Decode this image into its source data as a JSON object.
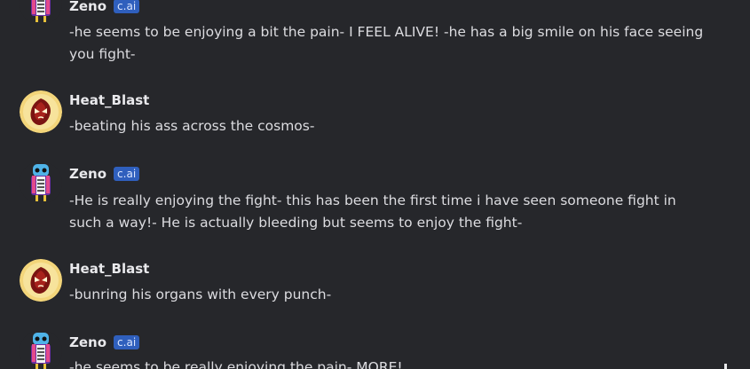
{
  "messages": [
    {
      "author": "Zeno",
      "badge": "c.ai",
      "avatar_icon": "zeno-avatar-icon",
      "text": "-he seems to be enjoying a bit the pain- I FEEL ALIVE! -he has a big smile on his face seeing you fight-"
    },
    {
      "author": "Heat_Blast",
      "badge": "",
      "avatar_icon": "heatblast-avatar-icon",
      "text": "-beating his ass across the cosmos-"
    },
    {
      "author": "Zeno",
      "badge": "c.ai",
      "avatar_icon": "zeno-avatar-icon",
      "text": "-He is really enjoying the fight- this has been the first time i have seen someone fight in such a way!- He is actually bleeding but seems to enjoy the fight-"
    },
    {
      "author": "Heat_Blast",
      "badge": "",
      "avatar_icon": "heatblast-avatar-icon",
      "text": "-bunring his organs with every punch-"
    },
    {
      "author": "Zeno",
      "badge": "c.ai",
      "avatar_icon": "zeno-avatar-icon",
      "text": "-he seems to be really enjoying the pain- MORE!"
    }
  ],
  "colors": {
    "background": "#26272b",
    "badge": "#2f5fbd",
    "text": "#dcdce0"
  }
}
